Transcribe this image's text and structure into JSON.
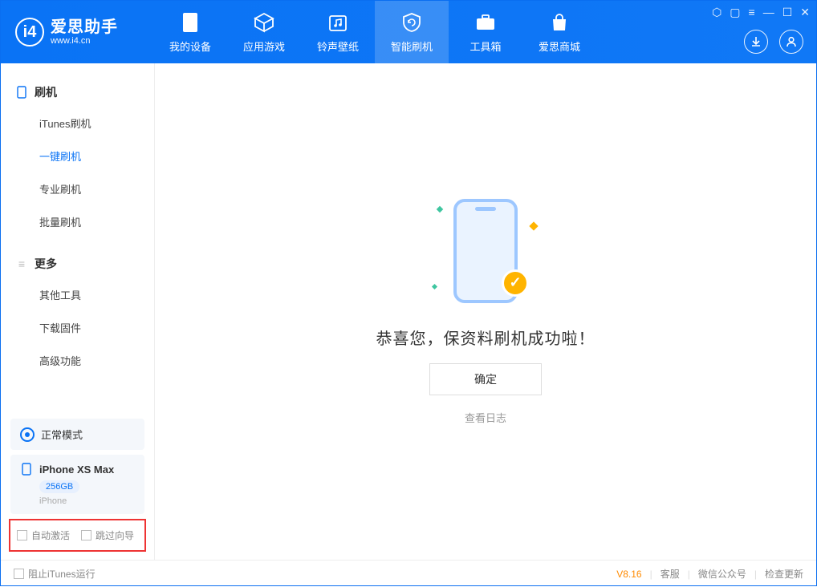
{
  "app": {
    "name": "爱思助手",
    "url": "www.i4.cn"
  },
  "tabs": [
    {
      "label": "我的设备"
    },
    {
      "label": "应用游戏"
    },
    {
      "label": "铃声壁纸"
    },
    {
      "label": "智能刷机"
    },
    {
      "label": "工具箱"
    },
    {
      "label": "爱思商城"
    }
  ],
  "sidebar": {
    "section1": {
      "title": "刷机",
      "items": [
        "iTunes刷机",
        "一键刷机",
        "专业刷机",
        "批量刷机"
      ],
      "active_index": 1
    },
    "section2": {
      "title": "更多",
      "items": [
        "其他工具",
        "下载固件",
        "高级功能"
      ]
    },
    "mode_card": {
      "label": "正常模式"
    },
    "device_card": {
      "name": "iPhone XS Max",
      "storage": "256GB",
      "type": "iPhone"
    },
    "options": {
      "auto_activate": "自动激活",
      "skip_guide": "跳过向导"
    }
  },
  "main": {
    "message": "恭喜您，保资料刷机成功啦！",
    "ok": "确定",
    "view_log": "查看日志"
  },
  "footer": {
    "block_itunes": "阻止iTunes运行",
    "version": "V8.16",
    "links": [
      "客服",
      "微信公众号",
      "检查更新"
    ]
  }
}
